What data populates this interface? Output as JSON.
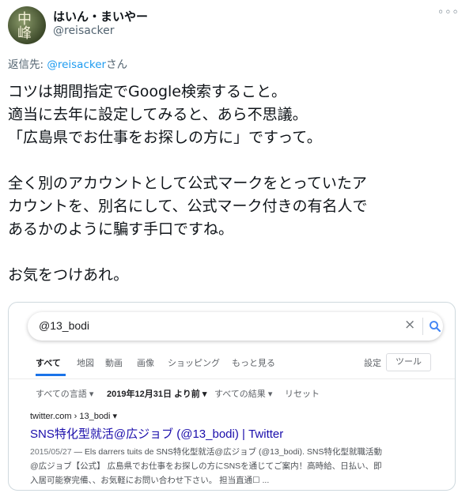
{
  "tweet": {
    "author_name": "はいん・まいやー",
    "author_handle": "@reisacker",
    "more_label": "◦◦◦",
    "avatar_text": "中峰",
    "reply_prefix": "返信先: ",
    "reply_handle": "@reisacker",
    "reply_suffix": "さん",
    "lines": [
      "コツは期間指定でGoogle検索すること。",
      "適当に去年に設定してみると、あら不思議。",
      "「広島県でお仕事をお探しの方に」ですって。",
      "",
      "全く別のアカウントとして公式マークをとっていたア",
      "カウントを、別名にして、公式マーク付きの有名人で",
      "あるかのように騙す手口ですね。",
      "",
      "お気をつけあれ。"
    ]
  },
  "google": {
    "query": "@13_bodi",
    "clear_icon": "×",
    "tabs": [
      "すべて",
      "地図",
      "動画",
      "画像",
      "ショッピング",
      "もっと見る"
    ],
    "settings": "設定",
    "tools": "ツール",
    "filters": {
      "language": "すべての言語 ▾",
      "date": "2019年12月31日 より前 ▾",
      "results": "すべての結果 ▾",
      "reset": "リセット"
    },
    "result": {
      "url": "twitter.com › 13_bodi ▾",
      "title": "SNS特化型就活@広ジョブ (@13_bodi) | Twitter",
      "date": "2015/05/27",
      "snippet_line1": " — Els darrers tuits de SNS特化型就活@広ジョブ (@13_bodi). SNS特化型就職活動",
      "snippet_line2": "@広ジョブ【公式】 広島県でお仕事をお探しの方にSNSを通じてご案内！高時給、日払い、即",
      "snippet_line3": "入居可能寮完備、、お気軽にお問い合わせ下さい。 担当直通☐ ..."
    }
  },
  "colors": {
    "link_blue": "#1d9bf0",
    "result_title": "#1a0dab",
    "google_blue": "#1a73e8"
  }
}
